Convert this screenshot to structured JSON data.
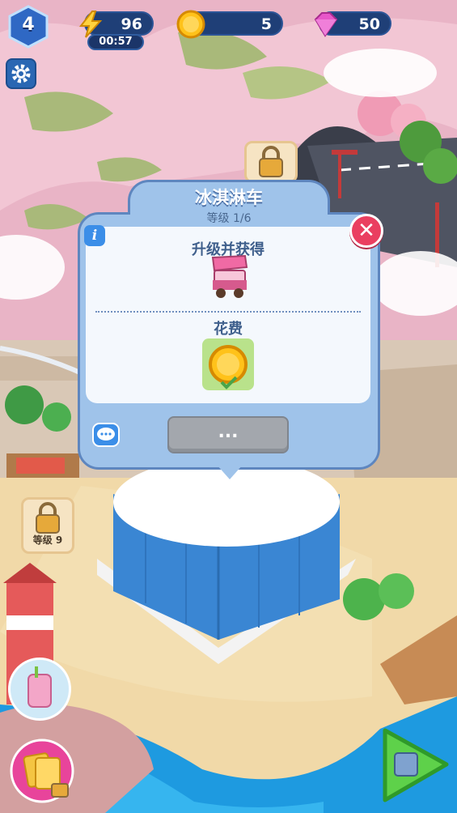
{
  "hud": {
    "player_level": "4",
    "energy": "96",
    "energy_timer": "00:57",
    "coins": "5",
    "gems": "50"
  },
  "dialog": {
    "title": "冰淇淋车",
    "level_text": "等级 1/6",
    "reward_label": "升级并获得",
    "cost_label": "花费",
    "upgrade_button_label": "...",
    "info_icon": "i"
  },
  "map": {
    "locked_building_level": "等级 9"
  },
  "icons": {
    "settings": "gear-icon",
    "energy": "lightning-icon",
    "coin": "coin-icon",
    "gem": "gem-icon",
    "close": "close-icon",
    "chat": "chat-bubble-icon",
    "lock": "padlock-icon"
  },
  "colors": {
    "dialog_bg": "#9fc3ea",
    "close": "#ea3f60",
    "button_disabled": "#a3a7ad",
    "cost_tile": "#b9e28b"
  }
}
